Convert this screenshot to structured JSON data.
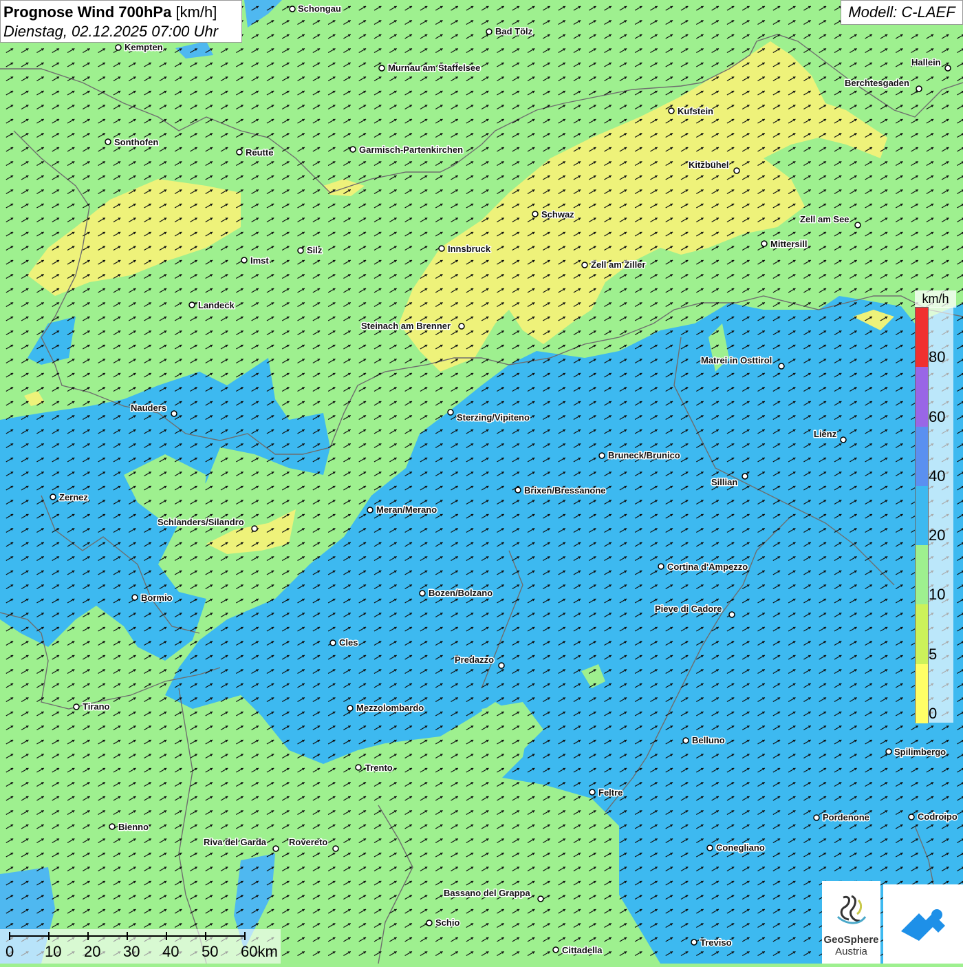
{
  "header": {
    "title_bold": "Prognose Wind 700hPa",
    "title_unit": "[km/h]",
    "datetime": "Dienstag, 02.12.2025 07:00 Uhr",
    "model": "Modell: C-LAEF"
  },
  "colors": {
    "speed_0_5": "#eef27a",
    "speed_10_20": "#9ef08f",
    "speed_20_40": "#3db9f0",
    "water": "#4fb8f0",
    "border": "#6e6e6e"
  },
  "legend": {
    "unit": "km/h",
    "ticks": [
      "0",
      "5",
      "10",
      "20",
      "40",
      "60",
      "80"
    ],
    "colors": [
      "#ffff66",
      "#ccf25a",
      "#9ef08f",
      "#3db9f0",
      "#5a90f0",
      "#9966e6",
      "#f03030"
    ]
  },
  "scale_bar": {
    "labels": [
      "0",
      "10",
      "20",
      "30",
      "40",
      "50",
      "60km"
    ]
  },
  "logos": {
    "geosphere_line1": "GeoSphere",
    "geosphere_line2": "Austria"
  },
  "wind": {
    "direction_deg_from_north": 60,
    "speed_zones": [
      "10-20 km/h north-west and south",
      "5-10 km/h band along the Inn valley",
      "20-40 km/h over the Dolomites and Veneto"
    ]
  },
  "cities": [
    {
      "name": "Schongau"
    },
    {
      "name": "Bad Tölz"
    },
    {
      "name": "Kempten"
    },
    {
      "name": "Murnau am Staffelsee"
    },
    {
      "name": "Hallein"
    },
    {
      "name": "Berchtesgaden"
    },
    {
      "name": "Kufstein"
    },
    {
      "name": "Sonthofen"
    },
    {
      "name": "Reutte"
    },
    {
      "name": "Garmisch-Partenkirchen"
    },
    {
      "name": "Kitzbühel"
    },
    {
      "name": "Schwaz"
    },
    {
      "name": "Zell am See"
    },
    {
      "name": "Innsbruck"
    },
    {
      "name": "Mittersill"
    },
    {
      "name": "Silz"
    },
    {
      "name": "Imst"
    },
    {
      "name": "Zell am Ziller"
    },
    {
      "name": "Landeck"
    },
    {
      "name": "Steinach am Brenner"
    },
    {
      "name": "Matrei in Osttirol"
    },
    {
      "name": "Nauders"
    },
    {
      "name": "Sterzing/Vipiteno"
    },
    {
      "name": "Lienz"
    },
    {
      "name": "Bruneck/Brunico"
    },
    {
      "name": "Sillian"
    },
    {
      "name": "Zernez"
    },
    {
      "name": "Brixen/Bressanone"
    },
    {
      "name": "Meran/Merano"
    },
    {
      "name": "Schlanders/Silandro"
    },
    {
      "name": "Cortina d'Ampezzo"
    },
    {
      "name": "Bozen/Bolzano"
    },
    {
      "name": "Bormio"
    },
    {
      "name": "Pieve di Cadore"
    },
    {
      "name": "Cles"
    },
    {
      "name": "Predazzo"
    },
    {
      "name": "Tirano"
    },
    {
      "name": "Mezzolombardo"
    },
    {
      "name": "Belluno"
    },
    {
      "name": "Spilimbergo"
    },
    {
      "name": "Trento"
    },
    {
      "name": "Feltre"
    },
    {
      "name": "Pordenone"
    },
    {
      "name": "Codroipo"
    },
    {
      "name": "Bienno"
    },
    {
      "name": "Riva del Garda"
    },
    {
      "name": "Rovereto"
    },
    {
      "name": "Conegliano"
    },
    {
      "name": "Bassano del Grappa"
    },
    {
      "name": "Schio"
    },
    {
      "name": "Treviso"
    },
    {
      "name": "Cittadella"
    }
  ]
}
